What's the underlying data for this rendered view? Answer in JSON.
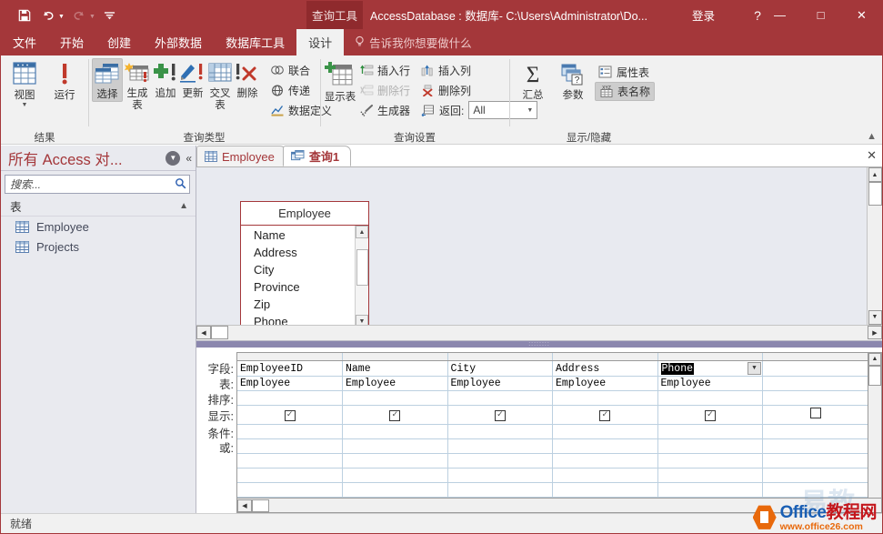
{
  "titlebar": {
    "quick_access": [
      {
        "name": "save-icon",
        "label": "保存"
      },
      {
        "name": "undo-icon",
        "label": "撤消"
      },
      {
        "name": "redo-icon",
        "label": "恢复"
      },
      {
        "name": "customize-qat-icon",
        "label": "自定义快速访问工具栏"
      }
    ],
    "context_tab": "查询工具",
    "title": "AccessDatabase : 数据库- C:\\Users\\Administrator\\Do...",
    "signin": "登录",
    "help": "?",
    "minimize": "—",
    "maximize": "□",
    "close": "✕"
  },
  "ribbon_tabs": {
    "items": [
      {
        "label": "文件",
        "active": false
      },
      {
        "label": "开始",
        "active": false
      },
      {
        "label": "创建",
        "active": false
      },
      {
        "label": "外部数据",
        "active": false
      },
      {
        "label": "数据库工具",
        "active": false
      },
      {
        "label": "设计",
        "active": true
      }
    ],
    "tellme": "告诉我你想要做什么"
  },
  "ribbon": {
    "groups": [
      {
        "label": "结果",
        "buttons": [
          {
            "label": "视图",
            "icon": "view-icon",
            "has_dropdown": true
          },
          {
            "label": "运行",
            "icon": "run-icon",
            "has_dropdown": false
          }
        ]
      },
      {
        "label": "查询类型",
        "buttons": [
          {
            "label": "选择",
            "icon": "select-query-icon",
            "active": true
          },
          {
            "label": "生成表",
            "icon": "make-table-query-icon",
            "active": false
          },
          {
            "label": "追加",
            "icon": "append-query-icon",
            "active": false
          },
          {
            "label": "更新",
            "icon": "update-query-icon",
            "active": false
          },
          {
            "label": "交叉表",
            "icon": "crosstab-query-icon",
            "active": false
          },
          {
            "label": "删除",
            "icon": "delete-query-icon",
            "active": false
          }
        ],
        "small_buttons": [
          {
            "label": "联合",
            "icon": "union-icon"
          },
          {
            "label": "传递",
            "icon": "passthrough-icon"
          },
          {
            "label": "数据定义",
            "icon": "data-definition-icon"
          }
        ]
      },
      {
        "label": "查询设置",
        "show_table": {
          "label": "显示表",
          "icon": "show-table-icon"
        },
        "items": [
          {
            "label": "插入行",
            "icon": "insert-row-icon",
            "disabled": false
          },
          {
            "label": "删除行",
            "icon": "delete-row-icon",
            "disabled": true
          },
          {
            "label": "生成器",
            "icon": "builder-icon",
            "disabled": false
          },
          {
            "label": "插入列",
            "icon": "insert-column-icon",
            "disabled": false
          },
          {
            "label": "删除列",
            "icon": "delete-column-icon",
            "disabled": false
          }
        ],
        "return_label": "返回:",
        "return_value": "All"
      },
      {
        "label": "显示/隐藏",
        "buttons": [
          {
            "label": "汇总",
            "icon": "totals-sigma-icon"
          },
          {
            "label": "参数",
            "icon": "parameters-icon"
          }
        ],
        "small_buttons": [
          {
            "label": "属性表",
            "icon": "property-sheet-icon",
            "active": false
          },
          {
            "label": "表名称",
            "icon": "table-names-icon",
            "active": true
          }
        ]
      }
    ],
    "collapse_icon": "chevron-up-icon"
  },
  "navpane": {
    "title": "所有 Access 对...",
    "dropdown_icon": "chevron-down-icon",
    "collapse_icon": "double-chevron-left-icon",
    "search_placeholder": "搜索...",
    "search_value": "",
    "search_icon": "search-icon",
    "group": {
      "label": "表",
      "collapse_icon": "double-chevron-up-icon"
    },
    "items": [
      {
        "label": "Employee",
        "icon": "table-icon"
      },
      {
        "label": "Projects",
        "icon": "table-icon"
      }
    ]
  },
  "doc_tabs": {
    "items": [
      {
        "label": "Employee",
        "icon": "table-icon",
        "active": false
      },
      {
        "label": "查询1",
        "icon": "query-icon",
        "active": true
      }
    ],
    "close_icon": "close-icon"
  },
  "design_view": {
    "field_list": {
      "title": "Employee",
      "fields": [
        "Name",
        "Address",
        "City",
        "Province",
        "Zip",
        "Phone"
      ],
      "scroll_up_icon": "scroll-up-icon",
      "scroll_down_icon": "scroll-down-icon"
    },
    "splitter_grip": "::::::::"
  },
  "query_grid": {
    "row_labels": [
      "字段:",
      "表:",
      "排序:",
      "显示:",
      "条件:",
      "或:"
    ],
    "columns": [
      {
        "field": "EmployeeID",
        "table": "Employee",
        "sort": "",
        "show": true,
        "criteria": "",
        "or": "",
        "selected": false
      },
      {
        "field": "Name",
        "table": "Employee",
        "sort": "",
        "show": true,
        "criteria": "",
        "or": "",
        "selected": false
      },
      {
        "field": "City",
        "table": "Employee",
        "sort": "",
        "show": true,
        "criteria": "",
        "or": "",
        "selected": false
      },
      {
        "field": "Address",
        "table": "Employee",
        "sort": "",
        "show": true,
        "criteria": "",
        "or": "",
        "selected": false
      },
      {
        "field": "Phone",
        "table": "Employee",
        "sort": "",
        "show": true,
        "criteria": "",
        "or": "",
        "selected": true
      },
      {
        "field": "",
        "table": "",
        "sort": "",
        "show": false,
        "criteria": "",
        "or": "",
        "selected": false
      }
    ],
    "checked_glyph": "✓",
    "dropdown_icon": "chevron-down-icon"
  },
  "statusbar": {
    "text": "就绪"
  },
  "watermark": {
    "brand_en": "Office",
    "brand_cn": "教程网",
    "url": "www.office26.com"
  },
  "colors": {
    "accent": "#a4373a",
    "context_tab": "#8f2a2d",
    "ribbon_bg": "#f1f1f1",
    "navpane_bg": "#e9eaef",
    "design_bg": "#e8eaf0",
    "splitter": "#8b87ae",
    "grid_line": "#bcd0e0"
  }
}
